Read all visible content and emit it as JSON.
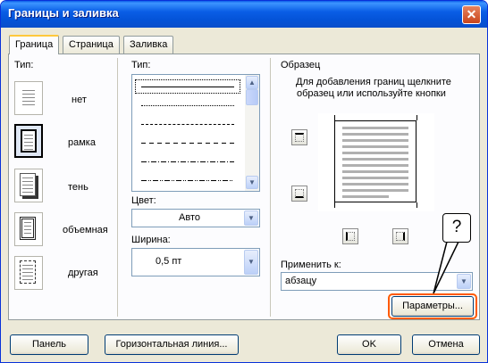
{
  "window": {
    "title": "Границы и заливка",
    "close_glyph": "✕"
  },
  "tabs": [
    {
      "label": "Граница",
      "active": true
    },
    {
      "label": "Страница",
      "active": false
    },
    {
      "label": "Заливка",
      "active": false
    }
  ],
  "setting": {
    "label": "Тип:",
    "options": [
      {
        "label": "нет",
        "icon": "none-border-icon",
        "selected": false
      },
      {
        "label": "рамка",
        "icon": "box-border-icon",
        "selected": true
      },
      {
        "label": "тень",
        "icon": "shadow-border-icon",
        "selected": false
      },
      {
        "label": "объемная",
        "icon": "3d-border-icon",
        "selected": false
      },
      {
        "label": "другая",
        "icon": "custom-border-icon",
        "selected": false
      }
    ]
  },
  "style": {
    "label": "Тип:",
    "line_styles": [
      "solid",
      "dotted",
      "dash-small",
      "dashed",
      "dash-dot",
      "dash-dot-dot"
    ],
    "selected_index": 0
  },
  "color": {
    "label": "Цвет:",
    "value": "Авто"
  },
  "width": {
    "label": "Ширина:",
    "value": "0,5 пт"
  },
  "preview": {
    "label": "Образец",
    "hint_line1": "Для добавления границ щелкните",
    "hint_line2": "образец или используйте кнопки"
  },
  "apply_to": {
    "label": "Применить к:",
    "value": "абзацу"
  },
  "buttons": {
    "options": "Параметры...",
    "panel": "Панель",
    "horizontal_line": "Горизонтальная линия...",
    "ok": "OK",
    "cancel": "Отмена"
  },
  "callout": {
    "text": "?"
  },
  "colors": {
    "titlebar": "#0a5ee6",
    "window_bg": "#ece9d8",
    "highlight": "#ff5a00",
    "tab_accent": "#ffc83c"
  }
}
